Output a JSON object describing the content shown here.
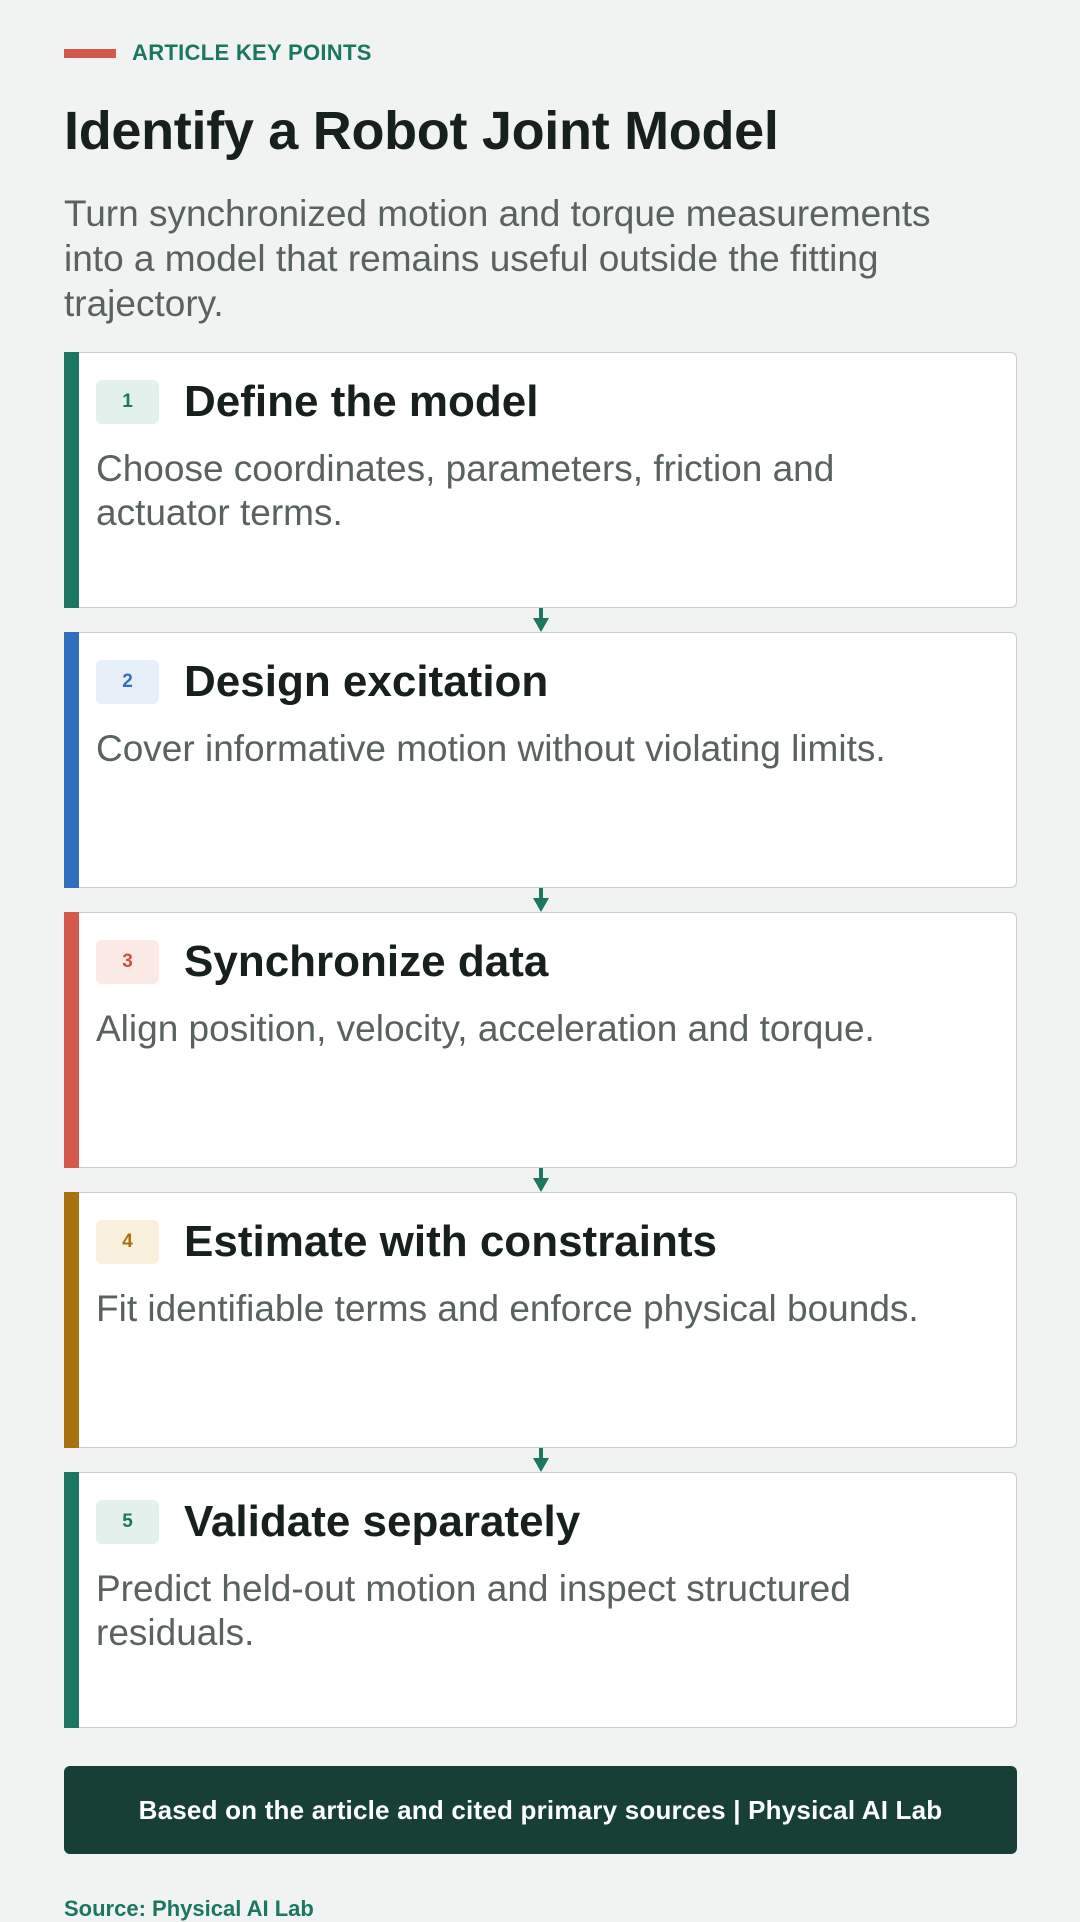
{
  "header": {
    "eyebrow": "ARTICLE KEY POINTS",
    "title": "Identify a Robot Joint Model",
    "subtitle": "Turn synchronized motion and torque measurements into a model that remains useful outside the fitting trajectory."
  },
  "steps": [
    {
      "number": "1",
      "title": "Define the model",
      "description": "Choose coordinates, parameters, friction and actuator terms.",
      "accent_color": "#1b7760",
      "badge_bg": "#e4f0ec",
      "badge_color": "#1b7760"
    },
    {
      "number": "2",
      "title": "Design excitation",
      "description": "Cover informative motion without violating limits.",
      "accent_color": "#2f6fbd",
      "badge_bg": "#e6eef8",
      "badge_color": "#2f6fbd"
    },
    {
      "number": "3",
      "title": "Synchronize data",
      "description": "Align position, velocity, acceleration and torque.",
      "accent_color": "#d35a4a",
      "badge_bg": "#fbe9e6",
      "badge_color": "#c7533f"
    },
    {
      "number": "4",
      "title": "Estimate with constraints",
      "description": "Fit identifiable terms and enforce physical bounds.",
      "accent_color": "#a8730f",
      "badge_bg": "#f8efdc",
      "badge_color": "#a8730f"
    },
    {
      "number": "5",
      "title": "Validate separately",
      "description": "Predict held-out motion and inspect structured residuals.",
      "accent_color": "#1b7760",
      "badge_bg": "#e4f0ec",
      "badge_color": "#1b7760"
    }
  ],
  "connector_color": "#1b7760",
  "footer": {
    "text": "Based on the article and cited primary sources | Physical AI Lab",
    "source": "Source: Physical AI Lab"
  }
}
